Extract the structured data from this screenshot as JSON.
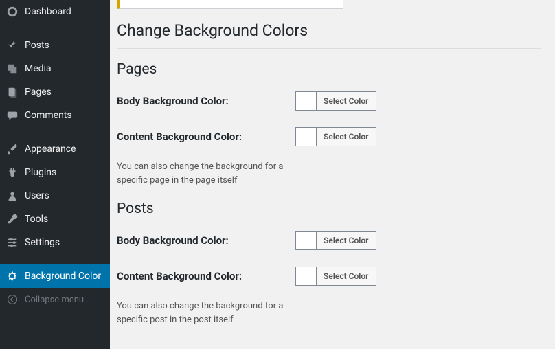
{
  "sidebar": {
    "items": [
      {
        "label": "Dashboard",
        "icon": "dashboard-icon"
      },
      {
        "label": "Posts",
        "icon": "pin-icon"
      },
      {
        "label": "Media",
        "icon": "media-icon"
      },
      {
        "label": "Pages",
        "icon": "page-icon"
      },
      {
        "label": "Comments",
        "icon": "comment-icon"
      },
      {
        "label": "Appearance",
        "icon": "brush-icon"
      },
      {
        "label": "Plugins",
        "icon": "plug-icon"
      },
      {
        "label": "Users",
        "icon": "user-icon"
      },
      {
        "label": "Tools",
        "icon": "wrench-icon"
      },
      {
        "label": "Settings",
        "icon": "sliders-icon"
      },
      {
        "label": "Background Color",
        "icon": "gear-icon"
      }
    ],
    "collapse_label": "Collapse menu"
  },
  "page": {
    "title": "Change Background Colors"
  },
  "sections": {
    "pages": {
      "heading": "Pages",
      "body_label": "Body Background Color:",
      "content_label": "Content Background Color:",
      "select_label": "Select Color",
      "description": "You can also change the background for a specific page in the page itself"
    },
    "posts": {
      "heading": "Posts",
      "body_label": "Body Background Color:",
      "content_label": "Content Background Color:",
      "select_label": "Select Color",
      "description": "You can also change the background for a specific post in the post itself"
    }
  }
}
